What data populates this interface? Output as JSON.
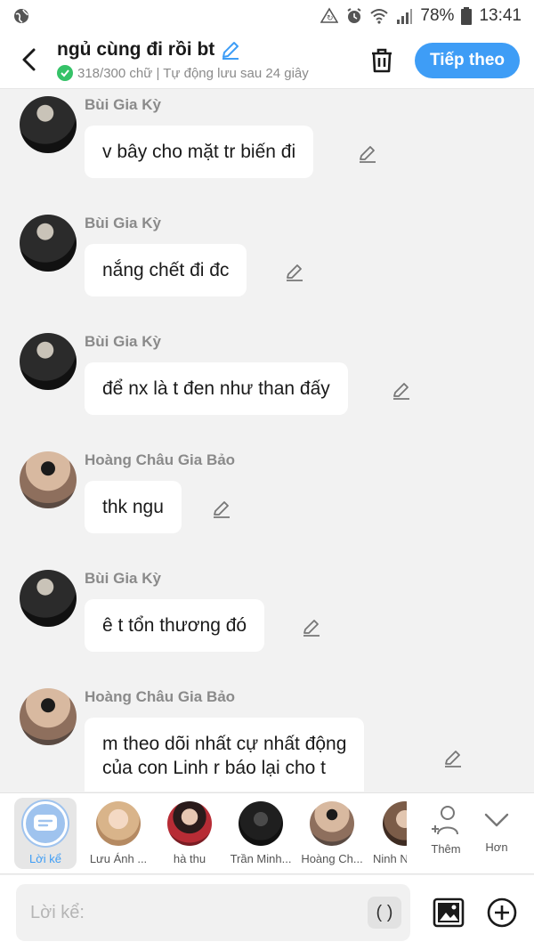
{
  "status_bar": {
    "battery": "78%",
    "time": "13:41"
  },
  "header": {
    "title": "ngủ cùng đi rồi bt",
    "subtitle": "318/300 chữ | Tự động lưu sau 24 giây",
    "next_label": "Tiếp theo"
  },
  "messages": [
    {
      "sender": "Bùi Gia Kỳ",
      "text": "v bây cho mặt tr biến đi"
    },
    {
      "sender": "Bùi Gia Kỳ",
      "text": "nắng chết đi đc"
    },
    {
      "sender": "Bùi Gia Kỳ",
      "text": "để nx là t đen như than đấy"
    },
    {
      "sender": "Hoàng Châu Gia Bảo",
      "text": "thk ngu"
    },
    {
      "sender": "Bùi Gia Kỳ",
      "text": "ê t tổn thương đó"
    },
    {
      "sender": "Hoàng Châu Gia Bảo",
      "text_line1": "m theo dõi nhất cự nhất động",
      "text_line2": "của con Linh r báo lại cho t"
    }
  ],
  "characters": [
    {
      "label": "Lời kể"
    },
    {
      "label": "Lưu Ánh ..."
    },
    {
      "label": "hà thu"
    },
    {
      "label": "Trần Minh..."
    },
    {
      "label": "Hoàng Ch..."
    },
    {
      "label": "Ninh N"
    }
  ],
  "more_label": "Thêm",
  "collapse_label": "Hơn",
  "input": {
    "placeholder": "Lời kể:",
    "paren_button": "( )"
  },
  "colors": {
    "accent": "#3e9df6",
    "success": "#35c268",
    "background": "#f2f2f2"
  }
}
